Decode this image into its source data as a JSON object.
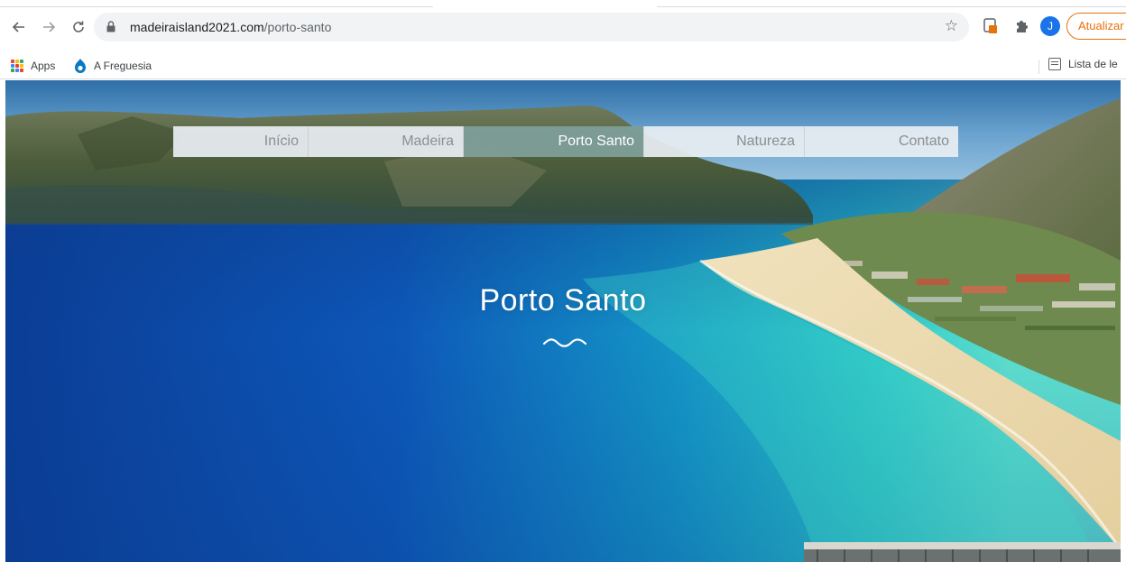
{
  "browser": {
    "url_host": "madeiraisland2021.com",
    "url_path": "/porto-santo",
    "avatar_letter": "J",
    "update_label": "Atualizar",
    "icons": {
      "back": "back-arrow-icon",
      "forward": "forward-arrow-icon",
      "reload": "reload-icon",
      "lock": "lock-icon",
      "bookmark": "star-icon"
    },
    "accent_color": "#e8710a"
  },
  "bookmarks": {
    "items": [
      {
        "label": "Apps",
        "icon": "apps-grid-icon"
      },
      {
        "label": "A Freguesia",
        "icon": "drupal-drop-icon"
      }
    ],
    "reading_list": "Lista de le"
  },
  "site": {
    "nav": [
      {
        "label": "Início",
        "active": false
      },
      {
        "label": "Madeira",
        "active": false
      },
      {
        "label": "Porto Santo",
        "active": true
      },
      {
        "label": "Natureza",
        "active": false
      },
      {
        "label": "Contato",
        "active": false
      }
    ],
    "hero_title": "Porto Santo",
    "nav_active_color": "#7d9e98"
  }
}
